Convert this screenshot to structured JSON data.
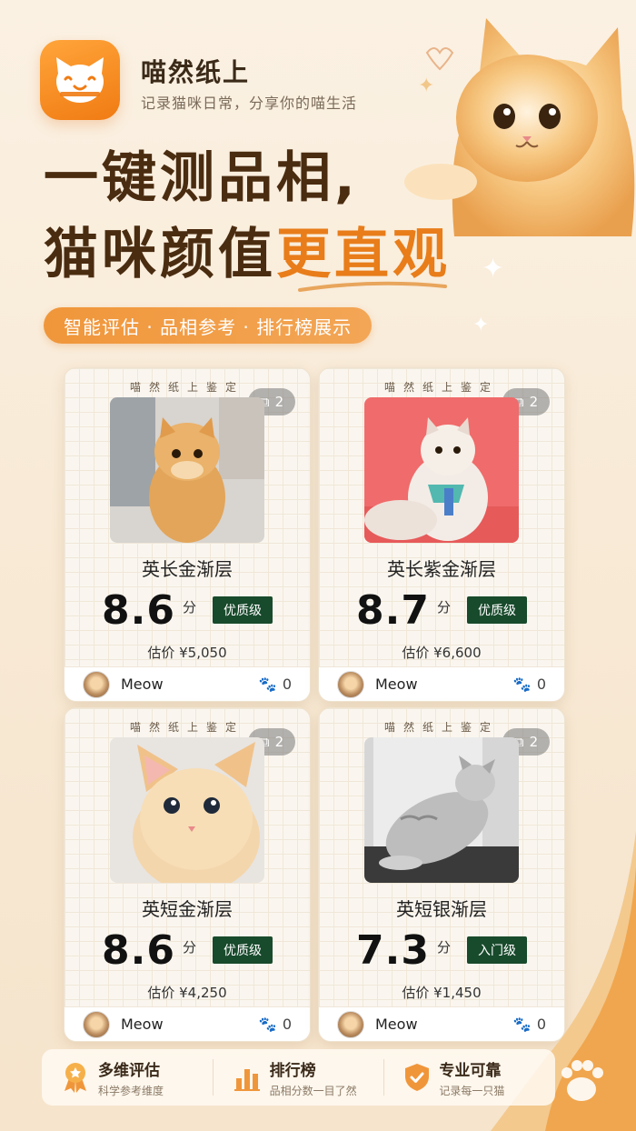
{
  "app": {
    "name": "喵然纸上",
    "tagline": "记录猫咪日常，分享你的喵生活"
  },
  "hero": {
    "headline_line1": "一键测品相,",
    "headline_line2_plain": "猫咪颜值",
    "headline_line2_accent": "更直观",
    "pill": "智能评估 · 品相参考 · 排行榜展示"
  },
  "cards": [
    {
      "stamp": "喵然纸上鉴定",
      "photo_count": "2",
      "breed": "英长金渐层",
      "score": "8.6",
      "unit": "分",
      "grade": "优质级",
      "price": "估价 ¥5,050",
      "user": "Meow",
      "likes": "0"
    },
    {
      "stamp": "喵然纸上鉴定",
      "photo_count": "2",
      "breed": "英长紫金渐层",
      "score": "8.7",
      "unit": "分",
      "grade": "优质级",
      "price": "估价 ¥6,600",
      "user": "Meow",
      "likes": "0"
    },
    {
      "stamp": "喵然纸上鉴定",
      "photo_count": "2",
      "breed": "英短金渐层",
      "score": "8.6",
      "unit": "分",
      "grade": "优质级",
      "price": "估价 ¥4,250",
      "user": "Meow",
      "likes": "0"
    },
    {
      "stamp": "喵然纸上鉴定",
      "photo_count": "2",
      "breed": "英短银渐层",
      "score": "7.3",
      "unit": "分",
      "grade": "入门级",
      "price": "估价 ¥1,450",
      "user": "Meow",
      "likes": "0"
    }
  ],
  "features": [
    {
      "title": "多维评估",
      "sub": "科学参考维度",
      "icon": "medal-icon"
    },
    {
      "title": "排行榜",
      "sub": "品相分数一目了然",
      "icon": "bar-chart-icon"
    },
    {
      "title": "专业可靠",
      "sub": "记录每一只猫",
      "icon": "shield-check-icon"
    }
  ],
  "colors": {
    "accent": "#e87d1a",
    "brand_orange": "#f07b13",
    "grade_badge": "#184a2c",
    "headline": "#4a2c10"
  }
}
